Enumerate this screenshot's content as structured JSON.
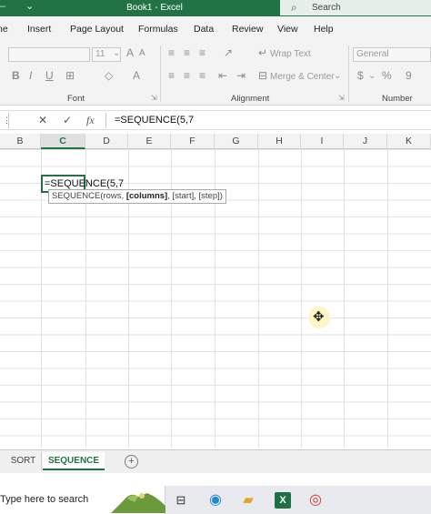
{
  "titlebar": {
    "title": "Book1  -  Excel",
    "search_placeholder": "Search",
    "dash": "‒",
    "qat_dropdown": "⌄"
  },
  "ribbon_tabs": [
    "ne",
    "Insert",
    "Page Layout",
    "Formulas",
    "Data",
    "Review",
    "View",
    "Help"
  ],
  "ribbon": {
    "font_size": "11",
    "bold": "B",
    "italic": "I",
    "underline": "U",
    "wrap_text": "Wrap Text",
    "merge_center": "Merge & Center",
    "number_format": "General",
    "currency": "$",
    "percent": "%",
    "comma": "9",
    "groups": {
      "font": "Font",
      "alignment": "Alignment",
      "number": "Number"
    }
  },
  "formula_bar": {
    "cancel": "✕",
    "enter": "✓",
    "fx": "fx",
    "formula": "=SEQUENCE(5,7"
  },
  "columns": [
    "B",
    "C",
    "D",
    "E",
    "F",
    "G",
    "H",
    "I",
    "J",
    "K"
  ],
  "active_cell": {
    "column": "C",
    "text": "=SEQUENCE(5,7"
  },
  "tooltip": {
    "fn": "SEQUENCE(rows, ",
    "bold_arg": "[columns]",
    "rest": ", [start], [step])"
  },
  "sheets": [
    {
      "name": "SORT",
      "active": false
    },
    {
      "name": "SEQUENCE",
      "active": true
    }
  ],
  "add_sheet": "+",
  "taskbar": {
    "search_text": "Type here to search"
  },
  "colors": {
    "accent": "#217346",
    "titlebar": "#217346",
    "cursor_highlight": "#fff6c6"
  }
}
